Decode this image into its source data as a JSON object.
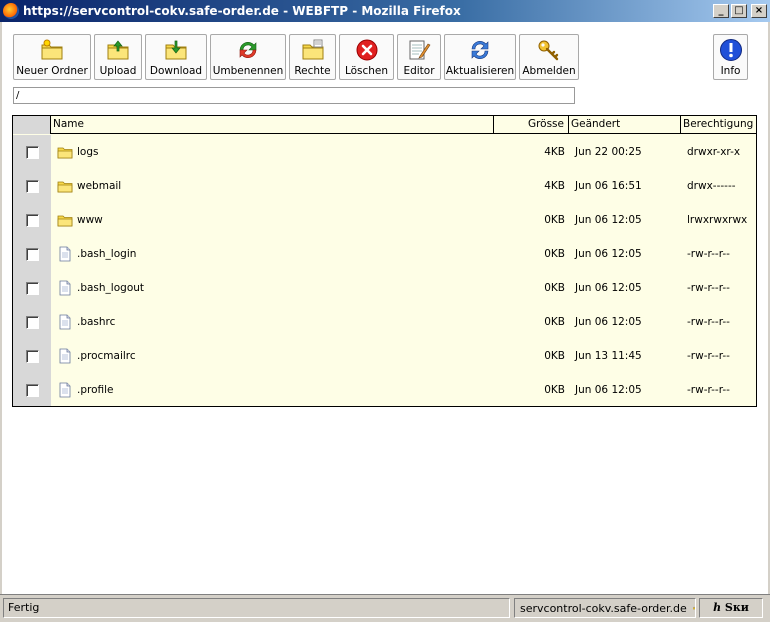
{
  "window": {
    "title": "https://servcontrol-cokv.safe-order.de - WEBFTP - Mozilla Firefox",
    "minimize": "_",
    "maximize": "□",
    "close": "×"
  },
  "toolbar": {
    "buttons": [
      {
        "label": "Neuer Ordner",
        "icon": "new-folder-icon"
      },
      {
        "label": "Upload",
        "icon": "upload-folder-icon"
      },
      {
        "label": "Download",
        "icon": "download-folder-icon"
      },
      {
        "label": "Umbenennen",
        "icon": "rename-arrows-icon"
      },
      {
        "label": "Rechte",
        "icon": "permissions-folder-icon"
      },
      {
        "label": "Löschen",
        "icon": "delete-icon"
      },
      {
        "label": "Editor",
        "icon": "editor-icon"
      },
      {
        "label": "Aktualisieren",
        "icon": "refresh-icon"
      },
      {
        "label": "Abmelden",
        "icon": "key-icon"
      }
    ],
    "info_label": "Info"
  },
  "path": {
    "value": "/"
  },
  "table": {
    "headers": {
      "name": "Name",
      "size": "Grösse",
      "date": "Geändert",
      "perm": "Berechtigung"
    },
    "rows": [
      {
        "type": "folder",
        "name": "logs",
        "size": "4KB",
        "date": "Jun 22 00:25",
        "perm": "drwxr-xr-x"
      },
      {
        "type": "folder",
        "name": "webmail",
        "size": "4KB",
        "date": "Jun 06 16:51",
        "perm": "drwx------"
      },
      {
        "type": "folder",
        "name": "www",
        "size": "0KB",
        "date": "Jun 06 12:05",
        "perm": "lrwxrwxrwx"
      },
      {
        "type": "file",
        "name": ".bash_login",
        "size": "0KB",
        "date": "Jun 06 12:05",
        "perm": "-rw-r--r--"
      },
      {
        "type": "file",
        "name": ".bash_logout",
        "size": "0KB",
        "date": "Jun 06 12:05",
        "perm": "-rw-r--r--"
      },
      {
        "type": "file",
        "name": ".bashrc",
        "size": "0KB",
        "date": "Jun 06 12:05",
        "perm": "-rw-r--r--"
      },
      {
        "type": "file",
        "name": ".procmailrc",
        "size": "0KB",
        "date": "Jun 13 11:45",
        "perm": "-rw-r--r--"
      },
      {
        "type": "file",
        "name": ".profile",
        "size": "0KB",
        "date": "Jun 06 12:05",
        "perm": "-rw-r--r--"
      }
    ]
  },
  "statusbar": {
    "text": "Fertig",
    "host": "servcontrol-cokv.safe-order.de",
    "extension": "ℎ Ѕки"
  },
  "colors": {
    "table_bg": "#fefee6",
    "folder_yellow": "#f7d84a",
    "titlebar_start": "#0a246a",
    "titlebar_end": "#a6caf0"
  }
}
